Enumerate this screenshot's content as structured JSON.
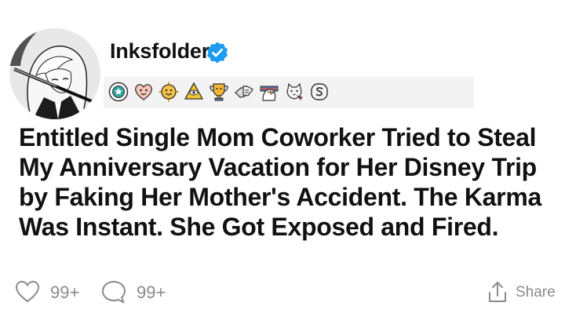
{
  "post": {
    "username": "Inksfolder",
    "title": "Entitled Single Mom Coworker Tried to Steal My Anniversary Vacation for Her Disney Trip by Faking Her Mother's Accident. The Karma Was Instant. She Got Exposed and Fired."
  },
  "awards": [
    {
      "icon": "silver-medal-icon",
      "color": "#2ea3a0"
    },
    {
      "icon": "heart-face-icon",
      "color": "#f06a5a"
    },
    {
      "icon": "sunny-face-icon",
      "color": "#f0b429"
    },
    {
      "icon": "eye-pyramid-icon",
      "color": "#e6b800"
    },
    {
      "icon": "trophy-face-icon",
      "color": "#e2a700"
    },
    {
      "icon": "fist-bump-icon",
      "color": "#9a9a9a"
    },
    {
      "icon": "eagle-icon",
      "color": "#4a6fa5"
    },
    {
      "icon": "cat-face-icon",
      "color": "#c0c0c0"
    },
    {
      "icon": "dollar-coin-icon",
      "color": "#7a7a7a"
    }
  ],
  "footer": {
    "likes": "99+",
    "comments": "99+",
    "share_label": "Share"
  },
  "colors": {
    "verified": "#1d9bf0",
    "muted": "#8a8a8a",
    "text": "#111111"
  }
}
